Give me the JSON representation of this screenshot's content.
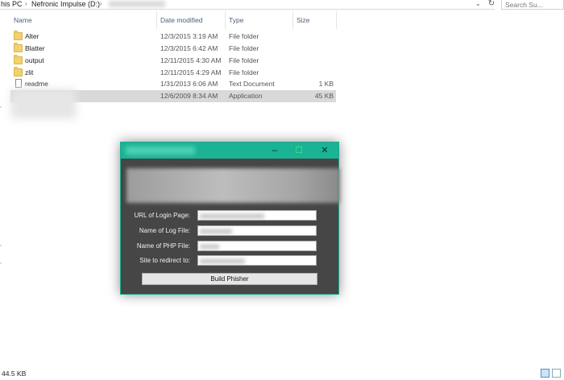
{
  "address_bar": {
    "crumb_this_pc": "his PC",
    "crumb_drive": "Nefronic Impulse (D:)",
    "separator": "›"
  },
  "search": {
    "placeholder": "Search Su..."
  },
  "columns": {
    "name": "Name",
    "date_modified": "Date modified",
    "type": "Type",
    "size": "Size"
  },
  "files": [
    {
      "name": "Alter",
      "date": "12/3/2015 3:19 AM",
      "type": "File folder",
      "size": "",
      "icon": "folder-icon"
    },
    {
      "name": "Blatter",
      "date": "12/3/2015 6:42 AM",
      "type": "File folder",
      "size": "",
      "icon": "folder-icon"
    },
    {
      "name": "output",
      "date": "12/11/2015 4:30 AM",
      "type": "File folder",
      "size": "",
      "icon": "folder-icon"
    },
    {
      "name": "zlit",
      "date": "12/11/2015 4:29 AM",
      "type": "File folder",
      "size": "",
      "icon": "folder-icon"
    },
    {
      "name": "readme",
      "date": "1/31/2013 6:06 AM",
      "type": "Text Document",
      "size": "1 KB",
      "icon": "text-document-icon"
    },
    {
      "name": "",
      "date": "12/6/2009 8:34 AM",
      "type": "Application",
      "size": "45 KB",
      "icon": "application-icon"
    }
  ],
  "status_bar": {
    "selection_size": "44.5 KB"
  },
  "phisher": {
    "labels": {
      "url": "URL of Login Page:",
      "log_file": "Name of Log File:",
      "php_file": "Name of PHP File:",
      "redirect": "Site to redirect to:"
    },
    "build_button": "Build Phisher",
    "minimize": "–",
    "maximize": "☐",
    "close": "✕"
  }
}
